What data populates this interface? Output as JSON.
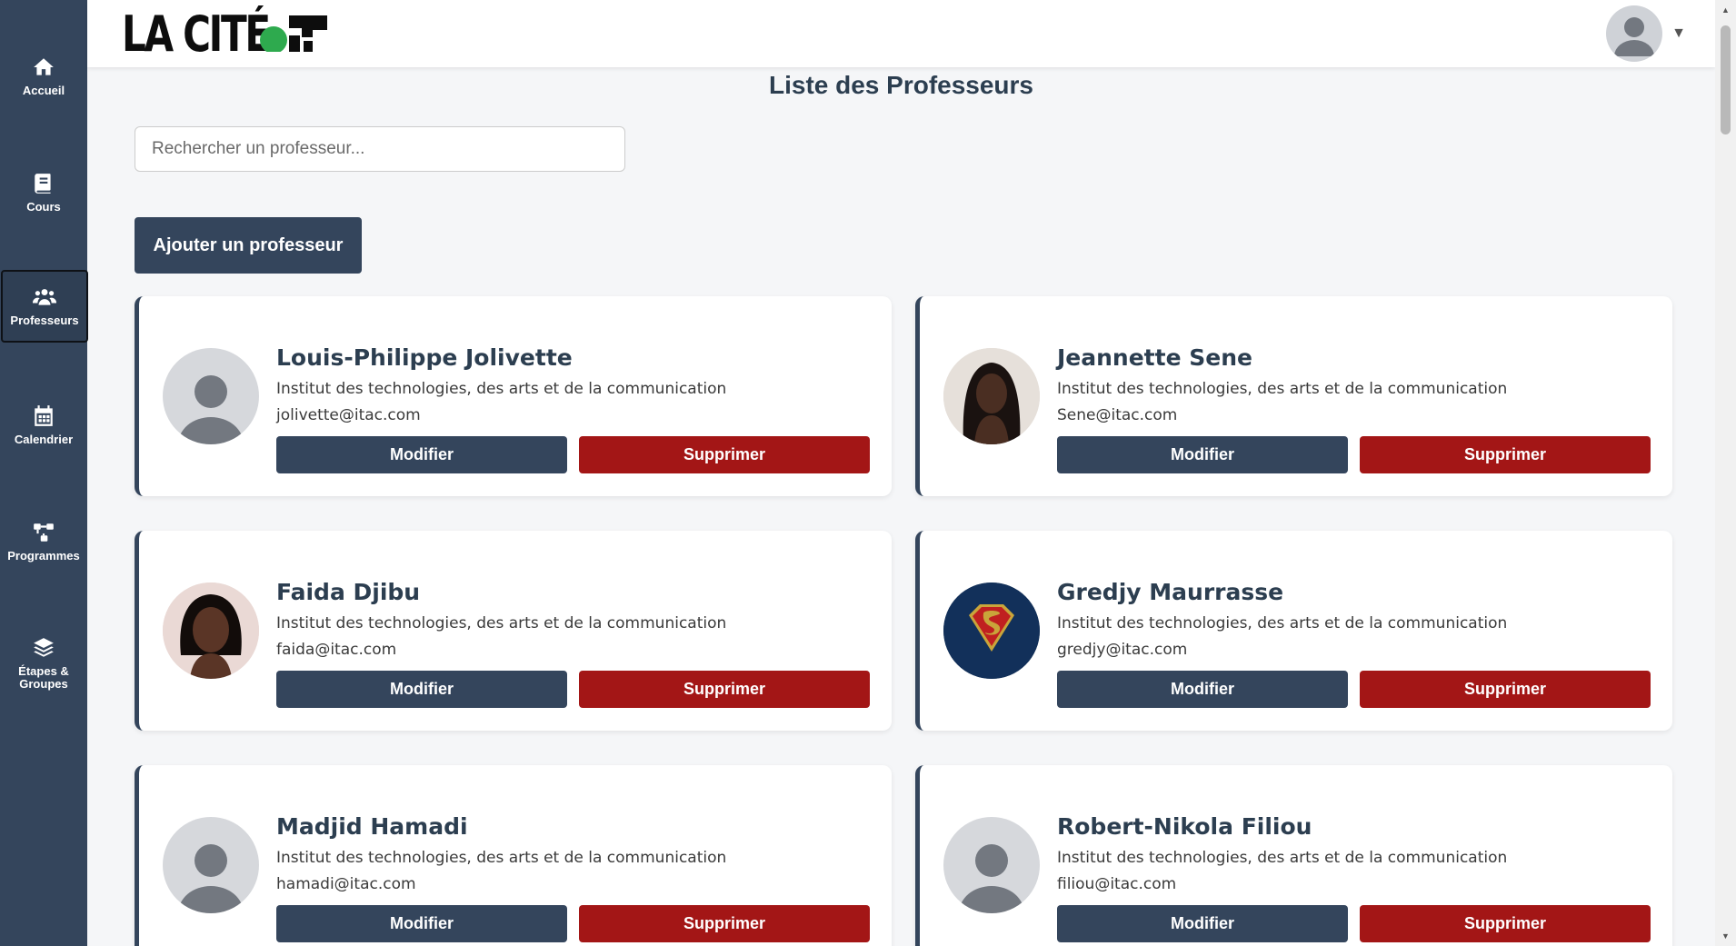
{
  "sidebar": {
    "items": [
      {
        "label": "Accueil",
        "icon": "home-icon"
      },
      {
        "label": "Cours",
        "icon": "book-icon"
      },
      {
        "label": "Professeurs",
        "icon": "users-icon",
        "active": true
      },
      {
        "label": "Calendrier",
        "icon": "calendar-icon"
      },
      {
        "label": "Programmes",
        "icon": "sitemap-icon"
      },
      {
        "label": "Étapes & Groupes",
        "icon": "layers-icon"
      }
    ]
  },
  "header": {
    "logo_text": "LA CITÉ",
    "user_avatar_icon": "user-avatar-icon",
    "menu_caret": "▼"
  },
  "main": {
    "title": "Liste des Professeurs",
    "search_placeholder": "Rechercher un professeur...",
    "add_button_label": "Ajouter un professeur"
  },
  "professors": [
    {
      "name": "Louis-Philippe Jolivette",
      "institute": "Institut des technologies, des arts et de la communication",
      "email": "jolivette@itac.com",
      "photo": "default-avatar"
    },
    {
      "name": "Jeannette Sene",
      "institute": "Institut des technologies, des arts et de la communication",
      "email": "Sene@itac.com",
      "photo": "portrait"
    },
    {
      "name": "Faida Djibu",
      "institute": "Institut des technologies, des arts et de la communication",
      "email": "faida@itac.com",
      "photo": "portrait"
    },
    {
      "name": "Gredjy Maurrasse",
      "institute": "Institut des technologies, des arts et de la communication",
      "email": "gredjy@itac.com",
      "photo": "superman-logo"
    },
    {
      "name": "Madjid Hamadi",
      "institute": "Institut des technologies, des arts et de la communication",
      "email": "hamadi@itac.com",
      "photo": "default-avatar"
    },
    {
      "name": "Robert-Nikola Filiou",
      "institute": "Institut des technologies, des arts et de la communication",
      "email": "filiou@itac.com",
      "photo": "default-avatar"
    }
  ],
  "card_actions": {
    "edit_label": "Modifier",
    "delete_label": "Supprimer"
  },
  "colors": {
    "sidebar": "#34455c",
    "primary": "#34455c",
    "danger": "#a31616",
    "logo_dot": "#2eaa4e"
  }
}
